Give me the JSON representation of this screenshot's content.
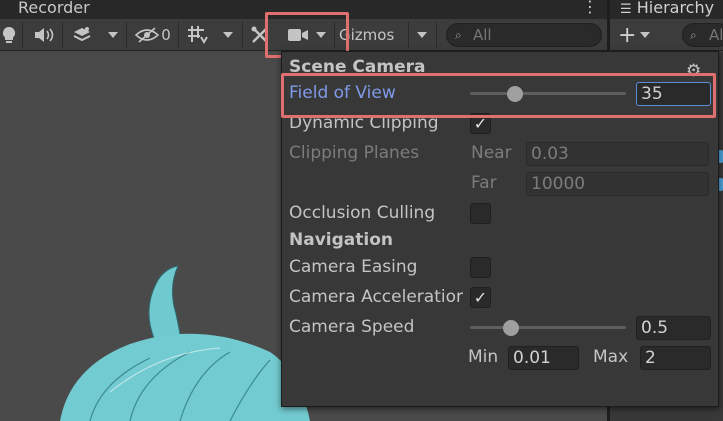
{
  "window": {
    "tab_title": "Recorder",
    "menu_dots": "⋮"
  },
  "toolbar": {
    "camera_icon": "video-camera-icon",
    "gizmos_label": "Gizmos",
    "hidden_count": "0",
    "search_placeholder": "All"
  },
  "hierarchy": {
    "tab_title": "Hierarchy",
    "add_label": "+",
    "search_placeholder": "All"
  },
  "scene_camera": {
    "section_title": "Scene Camera",
    "field_of_view": {
      "label": "Field of View",
      "value": "35",
      "fraction": 0.29
    },
    "dynamic_clipping": {
      "label": "Dynamic Clipping",
      "checked": true
    },
    "clipping_planes": {
      "label": "Clipping Planes",
      "near_label": "Near",
      "near_value": "0.03",
      "far_label": "Far",
      "far_value": "10000"
    },
    "occlusion_culling": {
      "label": "Occlusion Culling",
      "checked": false
    }
  },
  "navigation": {
    "section_title": "Navigation",
    "camera_easing": {
      "label": "Camera Easing",
      "checked": false
    },
    "camera_acceleration": {
      "label": "Camera Acceleratior",
      "checked": true
    },
    "camera_speed": {
      "label": "Camera Speed",
      "value": "0.5",
      "fraction": 0.26,
      "min_label": "Min",
      "min_value": "0.01",
      "max_label": "Max",
      "max_value": "2"
    }
  },
  "colors": {
    "highlight": "#e07070",
    "accent_label": "#7f9ae8",
    "hair": "#6fc9cf"
  }
}
